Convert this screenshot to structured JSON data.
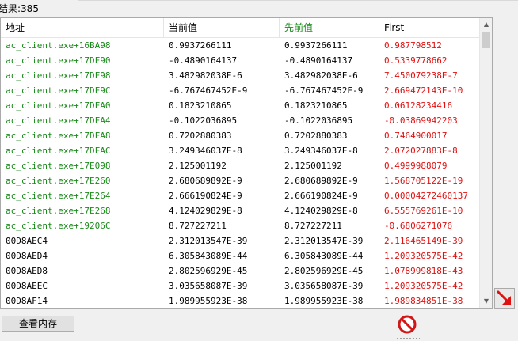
{
  "results": {
    "label": "结果:385"
  },
  "columns": {
    "address": "地址",
    "value": "当前值",
    "previous": "先前值",
    "first": "First"
  },
  "colors": {
    "pointer_address": "#1a8a1a",
    "first_value": "#e01010",
    "previous_header": "#1a8a1a"
  },
  "rows": [
    {
      "address": "ac_client.exe+16BA98",
      "value": "0.9937266111",
      "previous": "0.9937266111",
      "first": "0.987798512",
      "static": true
    },
    {
      "address": "ac_client.exe+17DF90",
      "value": "-0.4890164137",
      "previous": "-0.4890164137",
      "first": "0.5339778662",
      "static": true
    },
    {
      "address": "ac_client.exe+17DF98",
      "value": "3.482982038E-6",
      "previous": "3.482982038E-6",
      "first": "7.450079238E-7",
      "static": true
    },
    {
      "address": "ac_client.exe+17DF9C",
      "value": "-6.767467452E-9",
      "previous": "-6.767467452E-9",
      "first": "2.669472143E-10",
      "static": true
    },
    {
      "address": "ac_client.exe+17DFA0",
      "value": "0.1823210865",
      "previous": "0.1823210865",
      "first": "0.06128234416",
      "static": true
    },
    {
      "address": "ac_client.exe+17DFA4",
      "value": "-0.1022036895",
      "previous": "-0.1022036895",
      "first": "-0.03869942203",
      "static": true
    },
    {
      "address": "ac_client.exe+17DFA8",
      "value": "0.7202880383",
      "previous": "0.7202880383",
      "first": "0.7464900017",
      "static": true
    },
    {
      "address": "ac_client.exe+17DFAC",
      "value": "3.249346037E-8",
      "previous": "3.249346037E-8",
      "first": "2.072027883E-8",
      "static": true
    },
    {
      "address": "ac_client.exe+17E098",
      "value": "2.125001192",
      "previous": "2.125001192",
      "first": "0.4999988079",
      "static": true
    },
    {
      "address": "ac_client.exe+17E260",
      "value": "2.680689892E-9",
      "previous": "2.680689892E-9",
      "first": "1.568705122E-19",
      "static": true
    },
    {
      "address": "ac_client.exe+17E264",
      "value": "2.666190824E-9",
      "previous": "2.666190824E-9",
      "first": "0.00004272460137",
      "static": true
    },
    {
      "address": "ac_client.exe+17E268",
      "value": "4.124029829E-8",
      "previous": "4.124029829E-8",
      "first": "6.555769261E-10",
      "static": true
    },
    {
      "address": "ac_client.exe+19206C",
      "value": "8.727227211",
      "previous": "8.727227211",
      "first": "-0.6806271076",
      "static": true
    },
    {
      "address": "00D8AEC4",
      "value": "2.312013547E-39",
      "previous": "2.312013547E-39",
      "first": "2.116465149E-39",
      "static": false
    },
    {
      "address": "00D8AED4",
      "value": "6.305843089E-44",
      "previous": "6.305843089E-44",
      "first": "1.209320575E-42",
      "static": false
    },
    {
      "address": "00D8AED8",
      "value": "2.802596929E-45",
      "previous": "2.802596929E-45",
      "first": "1.078999818E-43",
      "static": false
    },
    {
      "address": "00D8AEEC",
      "value": "3.035658087E-39",
      "previous": "3.035658087E-39",
      "first": "1.209320575E-42",
      "static": false
    },
    {
      "address": "00D8AF14",
      "value": "1.989955923E-38",
      "previous": "1.989955923E-38",
      "first": "1.989834851E-38",
      "static": false
    }
  ],
  "buttons": {
    "view_memory": "查看内存"
  },
  "icons": {
    "add_to_list": "red-diagonal-arrow-icon",
    "stop": "no-entry-icon",
    "scroll_up": "scroll-up-arrow-icon",
    "scroll_down": "scroll-down-arrow-icon"
  }
}
